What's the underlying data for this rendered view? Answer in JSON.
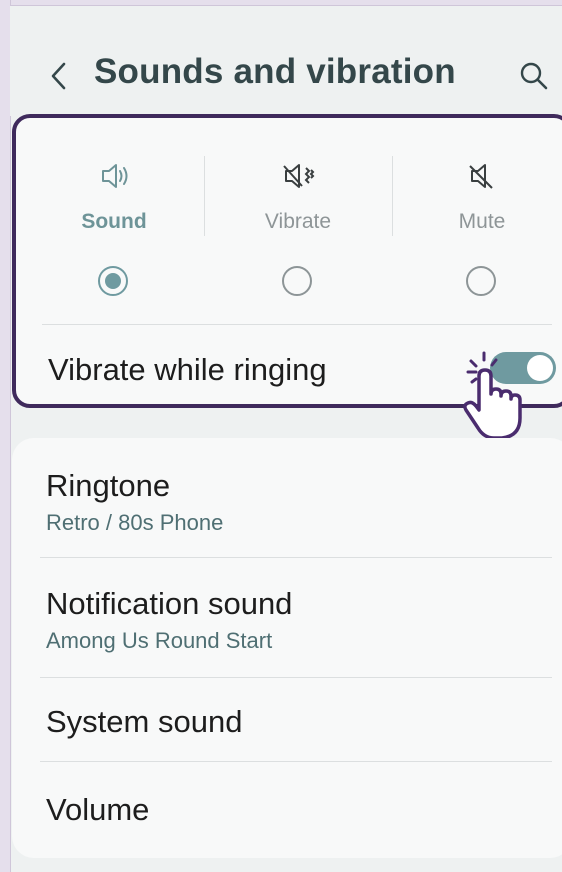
{
  "header": {
    "title": "Sounds and vibration",
    "back_icon": "chevron-left-icon",
    "search_icon": "search-icon"
  },
  "sound_mode": {
    "options": [
      {
        "label": "Sound",
        "icon": "speaker-sound-icon",
        "selected": true
      },
      {
        "label": "Vibrate",
        "icon": "speaker-vibrate-icon",
        "selected": false
      },
      {
        "label": "Mute",
        "icon": "speaker-mute-icon",
        "selected": false
      }
    ]
  },
  "vibrate_while_ringing": {
    "label": "Vibrate while ringing",
    "enabled": true
  },
  "settings": [
    {
      "title": "Ringtone",
      "subtitle": "Retro / 80s Phone"
    },
    {
      "title": "Notification sound",
      "subtitle": "Among Us Round Start"
    },
    {
      "title": "System sound"
    },
    {
      "title": "Volume"
    }
  ],
  "colors": {
    "accent": "#6f9aa0",
    "highlight_border": "#3f2a5c",
    "pointer": "#4a2c6e"
  }
}
